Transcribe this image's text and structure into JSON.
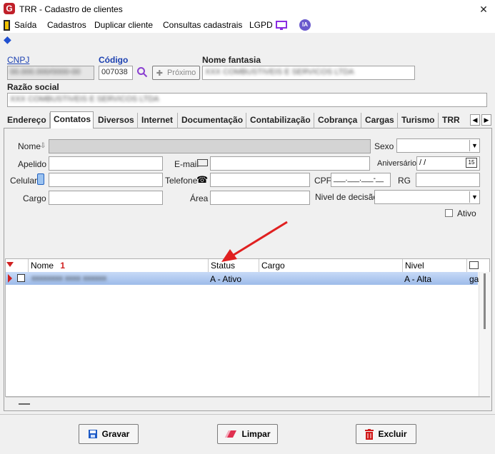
{
  "window": {
    "title": "TRR - Cadastro de clientes",
    "close": "✕"
  },
  "menu": {
    "items": [
      "Saída",
      "Cadastros",
      "Duplicar cliente",
      "Consultas cadastrais",
      "LGPD"
    ],
    "ia_badge": "IA"
  },
  "header": {
    "cnpj_label": "CNPJ",
    "cnpj_value": "00.000.000/0000-00",
    "codigo_label": "Código",
    "codigo_value": "007038",
    "proximo_label": "Próximo",
    "nome_fantasia_label": "Nome fantasia",
    "nome_fantasia_value": "XXX COMBUSTIVEIS E SERVICOS LTDA",
    "razao_social_label": "Razão social",
    "razao_social_value": "XXX COMBUSTIVEIS E SERVICOS LTDA"
  },
  "tabs": [
    "Endereço",
    "Contatos",
    "Diversos",
    "Internet",
    "Documentação",
    "Contabilização",
    "Cobrança",
    "Cargas",
    "Turismo",
    "TRR"
  ],
  "contact_form": {
    "nome_label": "Nome",
    "sexo_label": "Sexo",
    "apelido_label": "Apelido",
    "email_label": "E-mail",
    "aniversario_label": "Aniversário",
    "aniversario_value": " / /",
    "calendar_day": "15",
    "celular_label": "Celular",
    "telefone_label": "Telefone",
    "cpf_label": "CPF",
    "cpf_mask": "___.___.___-__",
    "rg_label": "RG",
    "cargo_label": "Cargo",
    "area_label": "Área",
    "nivel_label": "Nivel de decisão",
    "ativo_label": "Ativo"
  },
  "grid": {
    "columns": [
      "Nome",
      "Status",
      "Cargo",
      "Nivel"
    ],
    "sort_indicator": "1",
    "rows": [
      {
        "nome": "xxxxxxxx xxxx xxxxxx",
        "status": "A - Ativo",
        "cargo": "",
        "nivel": "A - Alta",
        "extra": "ga"
      }
    ]
  },
  "buttons": {
    "gravar": "Gravar",
    "limpar": "Limpar",
    "excluir": "Excluir"
  },
  "colors": {
    "link": "#1a3fb0",
    "selection": "#a9c4f0",
    "arrow": "#e02020",
    "accent": "#8a2be2"
  }
}
